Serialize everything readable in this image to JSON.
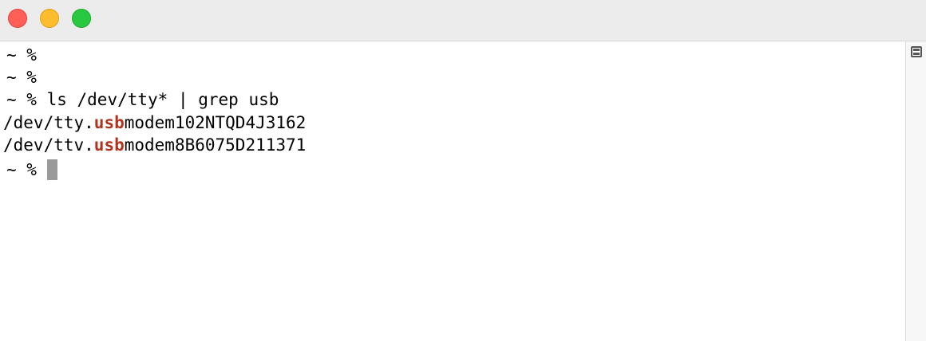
{
  "window": {
    "buttons": [
      "close",
      "minimize",
      "zoom"
    ]
  },
  "terminal": {
    "lines": [
      {
        "prompt": "~ %",
        "text": ""
      },
      {
        "prompt": "~ %",
        "text": ""
      },
      {
        "prompt": "~ %",
        "text": " ls /dev/tty* | grep usb"
      }
    ],
    "output": [
      {
        "before": "/dev/tty.",
        "match": "usb",
        "after": "modem102NTQD4J3162"
      },
      {
        "before": "/dev/ttv.",
        "match": "usb",
        "after": "modem8B6075D211371"
      }
    ],
    "current_prompt": "~ %",
    "highlight_color": "#b0341d"
  }
}
